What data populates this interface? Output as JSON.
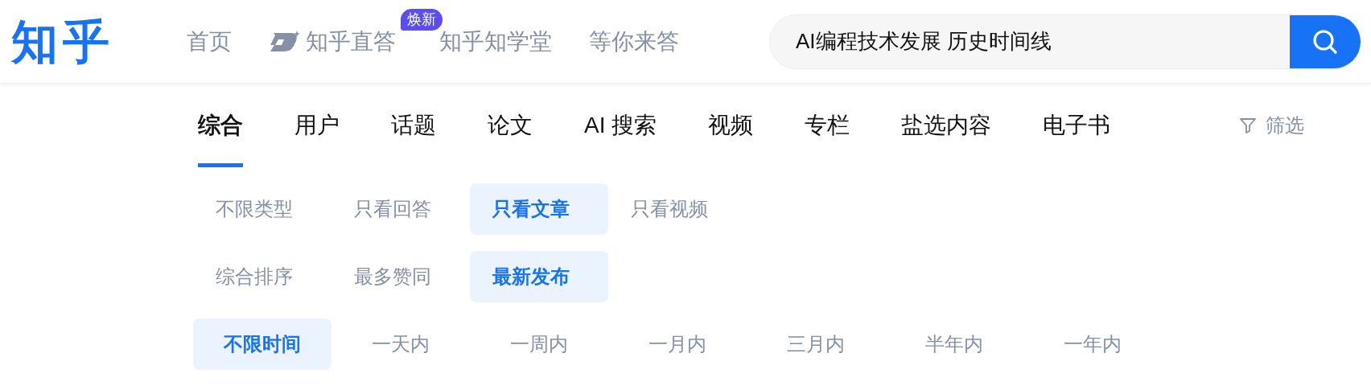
{
  "logo": "知乎",
  "nav": [
    {
      "label": "首页",
      "kind": "plain"
    },
    {
      "label": "知乎直答",
      "kind": "ai",
      "badge": "焕新"
    },
    {
      "label": "知乎知学堂",
      "kind": "plain"
    },
    {
      "label": "等你来答",
      "kind": "plain"
    }
  ],
  "search": {
    "value": "AI编程技术发展 历史时间线"
  },
  "tabs": [
    {
      "label": "综合",
      "selected": true
    },
    {
      "label": "用户",
      "selected": false
    },
    {
      "label": "话题",
      "selected": false
    },
    {
      "label": "论文",
      "selected": false
    },
    {
      "label": "AI 搜索",
      "selected": false
    },
    {
      "label": "视频",
      "selected": false
    },
    {
      "label": "专栏",
      "selected": false
    },
    {
      "label": "盐选内容",
      "selected": false
    },
    {
      "label": "电子书",
      "selected": false
    }
  ],
  "filter_button": {
    "label": "筛选"
  },
  "filter_rows": [
    {
      "options": [
        {
          "label": "不限类型",
          "selected": false
        },
        {
          "label": "只看回答",
          "selected": false
        },
        {
          "label": "只看文章",
          "selected": true
        },
        {
          "label": "只看视频",
          "selected": false
        }
      ]
    },
    {
      "options": [
        {
          "label": "综合排序",
          "selected": false
        },
        {
          "label": "最多赞同",
          "selected": false
        },
        {
          "label": "最新发布",
          "selected": true
        }
      ]
    },
    {
      "options": [
        {
          "label": "不限时间",
          "selected": true
        },
        {
          "label": "一天内",
          "selected": false
        },
        {
          "label": "一周内",
          "selected": false
        },
        {
          "label": "一月内",
          "selected": false
        },
        {
          "label": "三月内",
          "selected": false
        },
        {
          "label": "半年内",
          "selected": false
        },
        {
          "label": "一年内",
          "selected": false
        }
      ]
    }
  ]
}
